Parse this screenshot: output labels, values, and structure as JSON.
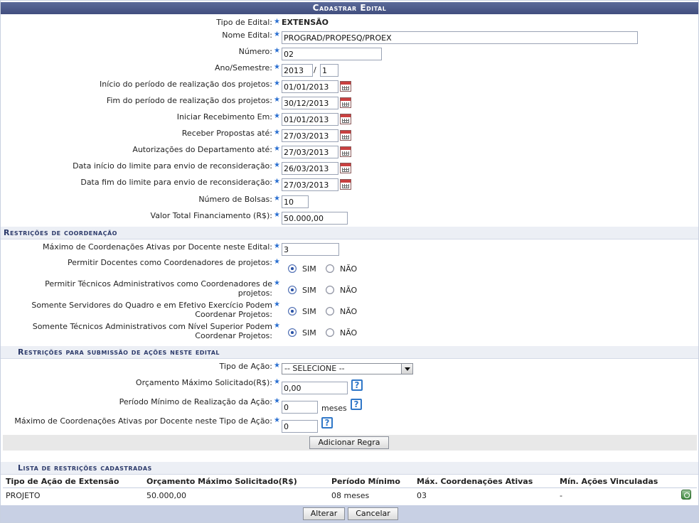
{
  "caption": "Cadastrar Edital",
  "form": {
    "tipo_label": "Tipo de Edital:",
    "tipo_value": "EXTENSÃO",
    "nome_label": "Nome Edital:",
    "nome_value": "PROGRAD/PROPESQ/PROEX",
    "numero_label": "Número:",
    "numero_value": "02",
    "ano_label": "Ano/Semestre:",
    "ano_value": "2013",
    "sem_sep": "/",
    "semestre_value": "1",
    "inicio_label": "Início do período de realização dos projetos:",
    "inicio_value": "01/01/2013",
    "fim_label": "Fim do período de realização dos projetos:",
    "fim_value": "30/12/2013",
    "iniciar_label": "Iniciar Recebimento Em:",
    "iniciar_value": "01/01/2013",
    "receber_label": "Receber Propostas até:",
    "receber_value": "27/03/2013",
    "autorizacoes_label": "Autorizações do Departamento até:",
    "autorizacoes_value": "27/03/2013",
    "recons_inicio_label": "Data início do limite para envio de reconsideração:",
    "recons_inicio_value": "26/03/2013",
    "recons_fim_label": "Data fim do limite para envio de reconsideração:",
    "recons_fim_value": "27/03/2013",
    "bolsas_label": "Número de Bolsas:",
    "bolsas_value": "10",
    "valor_label": "Valor Total Financiamento (R$):",
    "valor_value": "50.000,00"
  },
  "coord": {
    "section": "Restrições de coordenação",
    "max_label": "Máximo de Coordenações Ativas por Docente neste Edital:",
    "max_value": "3",
    "q1_label": "Permitir Docentes como Coordenadores de projetos:",
    "q2_label_1": "Permitir Técnicos Administrativos como Coordenadores de",
    "q2_label_2": "projetos:",
    "q3_label_1": "Somente Servidores do Quadro e em Efetivo Exercício Podem",
    "q3_label_2": "Coordenar Projetos:",
    "q4_label_1": "Somente Técnicos Administrativos com Nível Superior Podem",
    "q4_label_2": "Coordenar Projetos:",
    "sim": "SIM",
    "nao": "NÃO"
  },
  "submissao": {
    "section": "Restrições para submissão de ações neste edital",
    "tipo_label": "Tipo de Ação:",
    "tipo_value": "-- SELECIONE --",
    "orcamento_label": "Orçamento Máximo Solicitado(R$):",
    "orcamento_value": "0,00",
    "periodo_label": "Período Mínimo de Realização da Ação:",
    "periodo_value": "0",
    "periodo_unit": "meses",
    "maxcoord_label": "Máximo de Coordenações Ativas por Docente neste Tipo de Ação:",
    "maxcoord_value": "0",
    "help": "?",
    "add_button": "Adicionar Regra"
  },
  "lista": {
    "section": "Lista de restrições cadastradas",
    "headers": [
      "Tipo de Ação de Extensão",
      "Orçamento Máximo Solicitado(R$)",
      "Período Mínimo",
      "Máx. Coordenações Ativas",
      "Mín. Ações Vinculadas"
    ],
    "rows": [
      [
        "PROJETO",
        "50.000,00",
        "08 meses",
        "03",
        "-"
      ]
    ]
  },
  "footer": {
    "alterar": "Alterar",
    "cancelar": "Cancelar"
  }
}
